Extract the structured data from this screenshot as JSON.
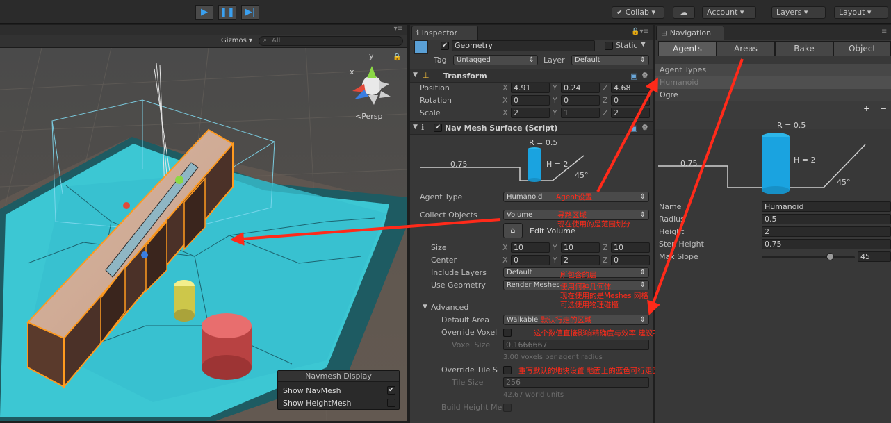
{
  "toolbar": {
    "collab": "Collab",
    "account": "Account",
    "layers": "Layers",
    "layout": "Layout"
  },
  "scene": {
    "gizmos": "Gizmos",
    "search_placeholder": "All",
    "persp": "Persp",
    "axis_y": "y",
    "axis_x": "x",
    "navmesh_display": {
      "title": "Navmesh Display",
      "show_navmesh": "Show NavMesh",
      "show_heightmesh": "Show HeightMesh"
    }
  },
  "inspector": {
    "tab": "Inspector",
    "object_name": "Geometry",
    "static": "Static",
    "tag_label": "Tag",
    "tag_value": "Untagged",
    "layer_label": "Layer",
    "layer_value": "Default",
    "transform": {
      "title": "Transform",
      "position_label": "Position",
      "rotation_label": "Rotation",
      "scale_label": "Scale",
      "position": {
        "x": "4.91",
        "y": "0.24",
        "z": "4.68"
      },
      "rotation": {
        "x": "0",
        "y": "0",
        "z": "0"
      },
      "scale": {
        "x": "2",
        "y": "1",
        "z": "2"
      }
    },
    "navmesh_surface": {
      "title": "Nav Mesh Surface (Script)",
      "diagram": {
        "r": "R = 0.5",
        "h": "H = 2",
        "step": "0.75",
        "slope": "45°"
      },
      "agent_type_label": "Agent Type",
      "agent_type_value": "Humanoid",
      "collect_objects_label": "Collect Objects",
      "collect_objects_value": "Volume",
      "edit_volume": "Edit Volume",
      "size_label": "Size",
      "size": {
        "x": "10",
        "y": "10",
        "z": "10"
      },
      "center_label": "Center",
      "center": {
        "x": "0",
        "y": "2",
        "z": "0"
      },
      "include_layers_label": "Include Layers",
      "include_layers_value": "Default",
      "use_geometry_label": "Use Geometry",
      "use_geometry_value": "Render Meshes",
      "advanced_label": "Advanced",
      "default_area_label": "Default Area",
      "default_area_value": "Walkable",
      "override_voxel_label": "Override Voxel",
      "voxel_size_label": "Voxel Size",
      "voxel_size_value": "0.1666667",
      "voxel_hint": "3.00 voxels per agent radius",
      "override_tile_label": "Override Tile S",
      "tile_size_label": "Tile Size",
      "tile_size_value": "256",
      "tile_hint": "42.67 world units",
      "build_height_label": "Build Height Me"
    },
    "notes": {
      "agent": "Agent设置",
      "collect_1": "寻路区域",
      "collect_2": "现在使用的是范围划分",
      "layers": "所包含的层",
      "geometry_1": "使用何种几何体",
      "geometry_2": "现在使用的是Meshes 网格",
      "geometry_3": "可选使用物理碰撞",
      "area": "默认行走的区域",
      "voxel": "这个数值直接影响精确度与效率  建议不要动",
      "tile": "重写默认的地块设置  地面上的蓝色可行走区域的几何体数量  数量越多越精确  建议不要动"
    }
  },
  "navigation": {
    "tab": "Navigation",
    "tabs": [
      "Agents",
      "Areas",
      "Bake",
      "Object"
    ],
    "agent_types_label": "Agent Types",
    "agent_types": [
      "Humanoid",
      "Ogre"
    ],
    "add": "+",
    "remove": "−",
    "diagram": {
      "r": "R = 0.5",
      "h": "H = 2",
      "step": "0.75",
      "slope": "45°"
    },
    "fields": {
      "name_label": "Name",
      "name_value": "Humanoid",
      "radius_label": "Radius",
      "radius_value": "0.5",
      "height_label": "Height",
      "height_value": "2",
      "step_label": "Step Height",
      "step_value": "0.75",
      "slope_label": "Max Slope",
      "slope_value": "45"
    }
  },
  "colors": {
    "navmesh": "#3fd3e0",
    "arrow": "#ff2a1a",
    "cylinder_red": "#e45b5b",
    "cylinder_yellow": "#d9d44a",
    "agent_blue": "#1aa3e0"
  }
}
